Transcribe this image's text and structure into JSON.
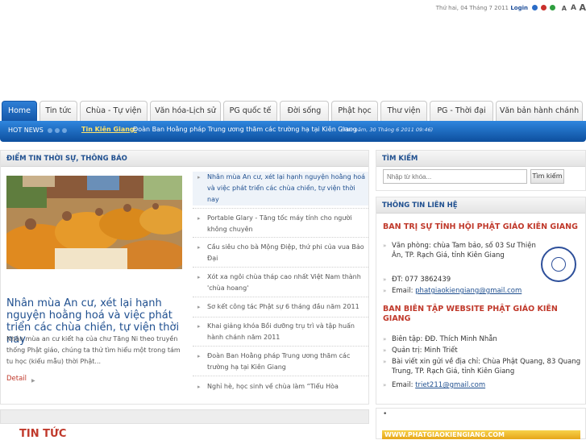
{
  "topbar": {
    "date": "Thứ hai, 04 Tháng 7 2011",
    "login": "Login",
    "color_dots": [
      "#2a6cc7",
      "#c9302c",
      "#2e9e3f",
      "#1d4e9a"
    ],
    "font_sizes": [
      "A",
      "A",
      "A"
    ]
  },
  "nav": {
    "tabs": [
      {
        "label": "Home",
        "active": true
      },
      {
        "label": "Tin tức"
      },
      {
        "label": "Chùa - Tự viện"
      },
      {
        "label": "Văn hóa-Lịch sử"
      },
      {
        "label": "PG quốc tế"
      },
      {
        "label": "Đời sống"
      },
      {
        "label": "Phật học"
      },
      {
        "label": "Thư viện"
      },
      {
        "label": "PG - Thời đại"
      },
      {
        "label": "Văn bản hành chánh"
      }
    ]
  },
  "hotnews": {
    "label": "HOT NEWS",
    "category": "Tin Kiên Giang:",
    "text": "Đoàn Ban Hoằng pháp Trung ương thăm các trường hạ tại Kiên Giang",
    "date": "(Thứ năm, 30 Tháng 6 2011 09:46)"
  },
  "main": {
    "heading": "ĐIỂM TIN THỜI SỰ, THÔNG BÁO",
    "feature": {
      "title": "Nhân mùa An cư, xét lại hạnh nguyện hoằng hoá và việc phát triển các chùa chiền, tự viện thời nay",
      "text": "Nhân mùa an cư kiết hạ của chư Tăng Ni theo truyền thống Phật giáo, chúng ta thử tìm hiểu một trong tám tu học (kiểu mẫu) thời Phật...",
      "detail": "Detail"
    },
    "news": [
      "Nhân mùa An cư, xét lại hạnh nguyện hoằng hoá và việc phát triển các chùa chiền, tự viện thời nay",
      "Portable Glary - Tăng tốc máy tính cho người không chuyên",
      "Cầu siêu cho bà Mộng Điệp, thứ phi của vua Bảo Đại",
      "Xót xa ngôi chùa tháp cao nhất Việt Nam thành 'chùa hoang'",
      "Sơ kết công tác Phật sự 6 tháng đầu năm 2011",
      "Khai giảng khóa Bồi dưỡng trụ trì và tập huấn hành chánh năm 2011",
      "Đoàn Ban Hoằng pháp Trung ương thăm các trường hạ tại Kiên Giang",
      "Nghỉ hè, học sinh về chùa làm “Tiểu Hòa"
    ]
  },
  "search": {
    "heading": "TÌM KIẾM",
    "placeholder": "Nhập từ khóa...",
    "button": "Tìm kiếm"
  },
  "contact": {
    "heading": "THÔNG TIN LIÊN HỆ",
    "org1": "BAN TRỊ SỰ TỈNH HỘI PHẬT GIÁO KIÊN GIANG",
    "office": "Văn phòng: chùa Tam bảo, số 03 Sư Thiện Ân, TP. Rạch Giá, tỉnh Kiên Giang",
    "phone": "ĐT: 077 3862439",
    "email_label": "Email: ",
    "email": "phatgiaokiengiang@gmail.com",
    "org2": "BAN BIÊN TẬP WEBSITE PHẬT GIÁO KIÊN GIANG",
    "editor": "Biên tập: ĐĐ. Thích Minh Nhẫn",
    "admin": "Quản trị: Minh Triết",
    "submit": "Bài viết xin gửi về địa chỉ: Chùa Phật Quang, 83 Quang Trung, TP. Rạch Giá, tỉnh Kiên Giang",
    "email2_label": "Email: ",
    "email2": "triet211@gmail.com"
  },
  "bottom": {
    "tin_tuc": "TIN TỨC",
    "dot": "•",
    "banner": "WWW.PHATGIAOKIENGIANG.COM"
  }
}
